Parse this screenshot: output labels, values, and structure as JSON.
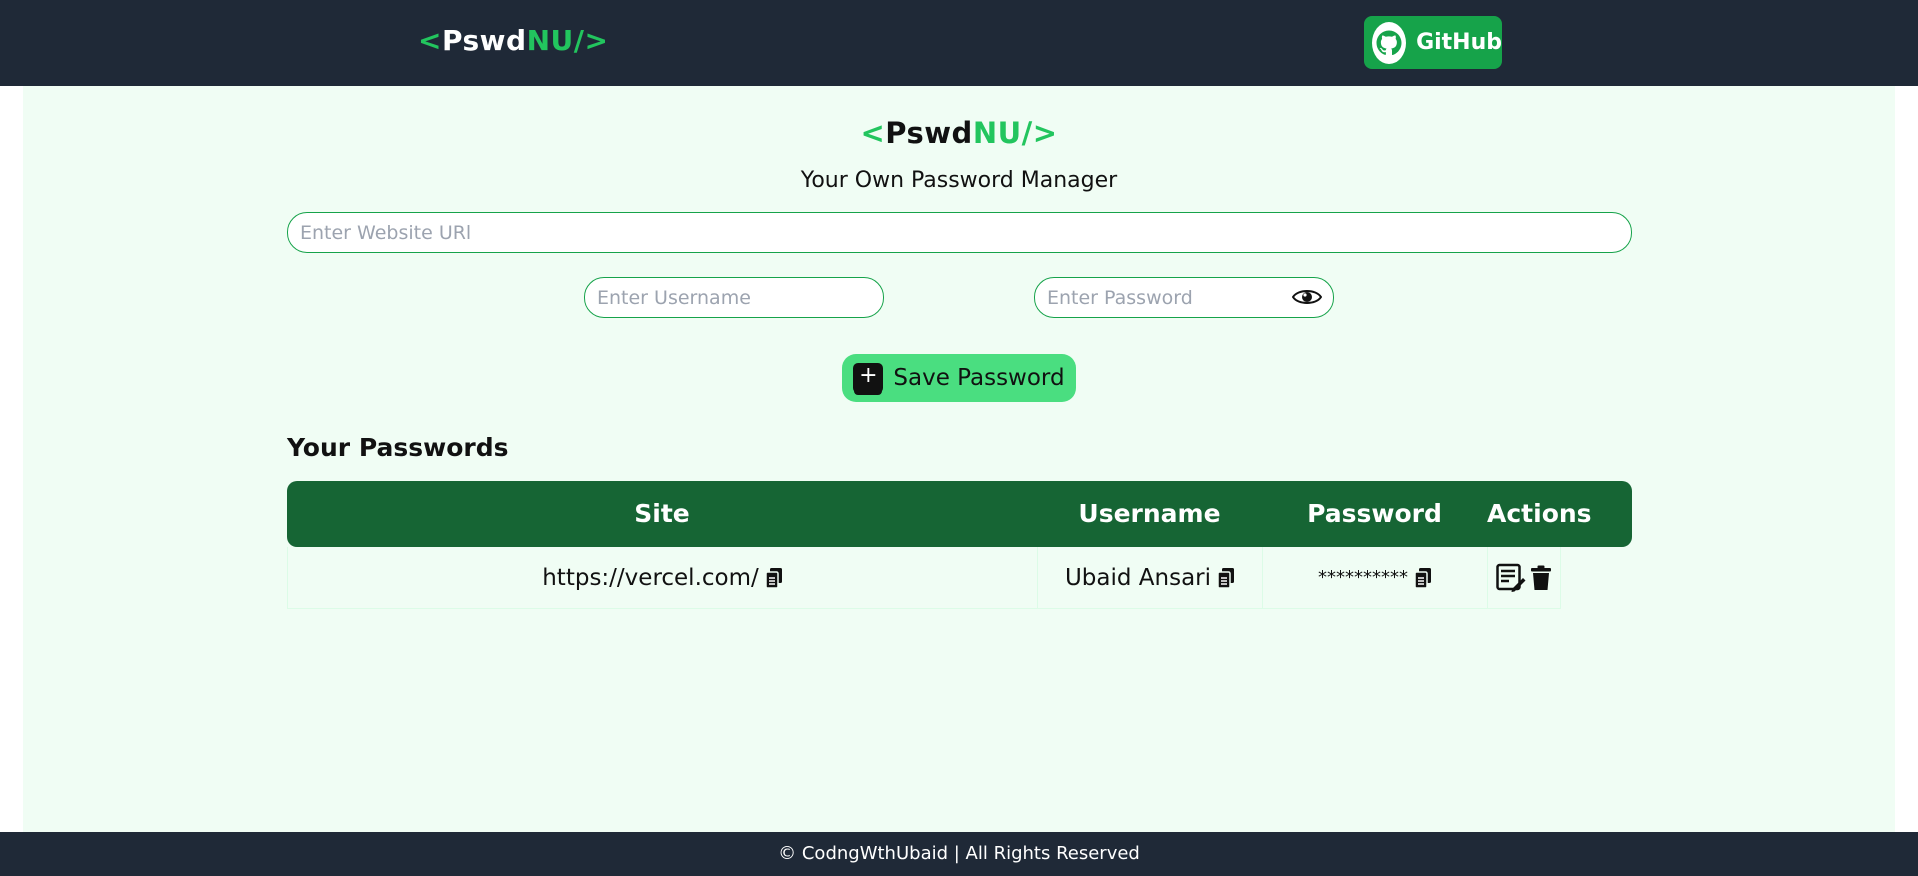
{
  "navbar": {
    "logo": {
      "open": "<",
      "pswd": "Pswd",
      "nu": "NU/",
      "close": ">"
    },
    "github_label": "GitHub"
  },
  "hero": {
    "logo": {
      "open": "<",
      "pswd": "Pswd",
      "nu": "NU/",
      "close": ">"
    },
    "subtitle": "Your Own Password Manager"
  },
  "form": {
    "url_placeholder": "Enter Website URl",
    "username_placeholder": "Enter Username",
    "password_placeholder": "Enter Password",
    "save_label": "Save Password"
  },
  "passwords": {
    "title": "Your Passwords",
    "columns": [
      "Site",
      "Username",
      "Password",
      "Actions"
    ],
    "rows": [
      {
        "site": "https://vercel.com/",
        "username": "Ubaid Ansari",
        "password": "**********"
      }
    ]
  },
  "footer": {
    "text": "© CodngWthUbaid | All Rights Reserved"
  },
  "colors": {
    "nav_bg": "#1f2937",
    "accent": "#22c55e",
    "main_bg": "#f0fdf4",
    "table_header": "#166534",
    "save_button": "#4ade80"
  },
  "icons": {
    "github": "github-octocat-icon",
    "eye": "eye-icon",
    "add": "plus-square-icon",
    "copy": "copy-icon",
    "edit": "edit-icon",
    "delete": "trash-icon"
  }
}
